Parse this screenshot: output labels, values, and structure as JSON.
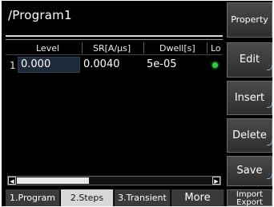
{
  "title": "/Program1",
  "table": {
    "columns": [
      "Level",
      "SR[A/µs]",
      "Dwell[s]",
      "Lo"
    ],
    "rows": [
      {
        "index": "1",
        "level": "0.000",
        "sr": "0.0040",
        "dwell": "5e-05",
        "lo_indicator": "green-led"
      }
    ]
  },
  "softkeys": {
    "property": "Property",
    "edit": "Edit",
    "insert": "Insert",
    "delete": "Delete",
    "save": "Save",
    "import_export_line1": "Import",
    "import_export_line2": "Export"
  },
  "tabs": {
    "program": "1.Program",
    "steps": "2.Steps",
    "transient": "3.Transient",
    "more": "More"
  },
  "scrollbar": {
    "left_arrow": "◀",
    "right_arrow": "▶"
  },
  "colors": {
    "background": "#000000",
    "selected_tab": "#d8d8d8",
    "led_green": "#2ecc40",
    "accent": "#7ab7e8"
  }
}
